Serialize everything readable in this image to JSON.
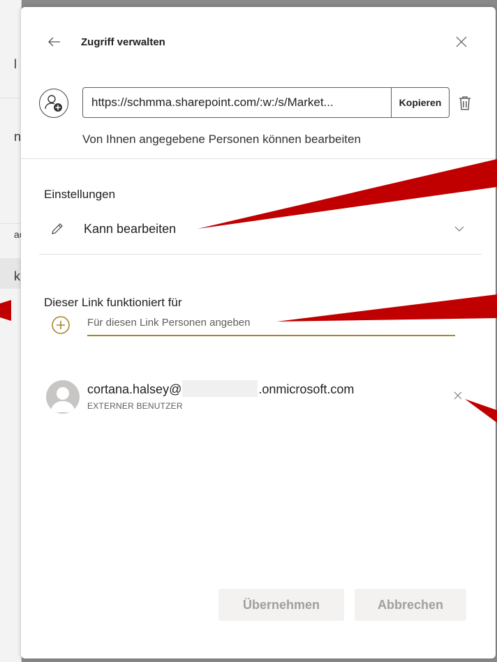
{
  "background_app": {
    "chars": [
      "l",
      "n",
      "ac",
      "k"
    ]
  },
  "header": {
    "title": "Zugriff verwalten",
    "back_icon": "arrow-left-icon",
    "close_icon": "close-icon"
  },
  "link": {
    "share_icon": "person-add-icon",
    "url": "https://schmma.sharepoint.com/:w:/s/Market...",
    "copy_label": "Kopieren",
    "delete_icon": "trash-icon",
    "description": "Von Ihnen angegebene Personen können bearbeiten"
  },
  "settings": {
    "heading": "Einstellungen",
    "permission_icon": "pencil-icon",
    "permission_label": "Kann bearbeiten",
    "dropdown_icon": "chevron-down-icon"
  },
  "people": {
    "heading": "Dieser Link funktioniert für",
    "add_icon": "plus-circle-icon",
    "input_placeholder": "Für diesen Link Personen angeben",
    "users": [
      {
        "email_prefix": "cortana.halsey@",
        "email_suffix": ".onmicrosoft.com",
        "type": "EXTERNER BENUTZER"
      }
    ]
  },
  "footer": {
    "apply_label": "Übernehmen",
    "cancel_label": "Abbrechen"
  },
  "colors": {
    "accent": "#a8862f",
    "annotation_arrow": "#c00000",
    "disabled_button_bg": "#f3f2f1",
    "disabled_button_text": "#a19f9d"
  }
}
